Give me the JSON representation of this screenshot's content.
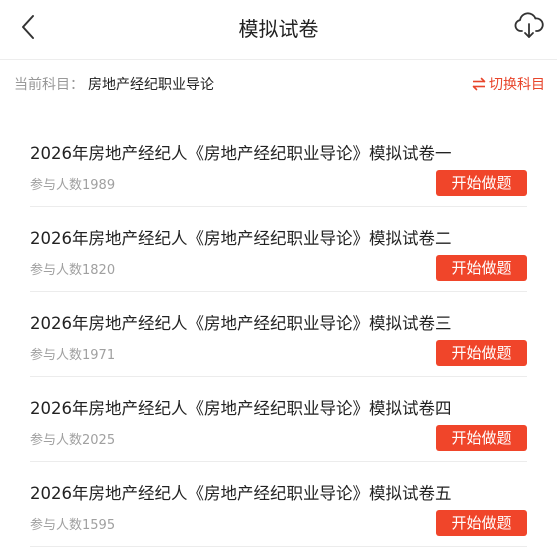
{
  "header": {
    "title": "模拟试卷",
    "back_icon": "chevron-left-icon",
    "download_icon": "cloud-download-icon"
  },
  "subject": {
    "label": "当前科目：",
    "value": "房地产经纪职业导论",
    "switch_label": "切换科目",
    "switch_icon": "swap-arrows-icon"
  },
  "colors": {
    "accent": "#f0452a",
    "muted_text": "#999999",
    "text": "#222222"
  },
  "papers": [
    {
      "title": "2026年房地产经纪人《房地产经纪职业导论》模拟试卷一",
      "participants": "参与人数1989",
      "action": "开始做题"
    },
    {
      "title": "2026年房地产经纪人《房地产经纪职业导论》模拟试卷二",
      "participants": "参与人数1820",
      "action": "开始做题"
    },
    {
      "title": "2026年房地产经纪人《房地产经纪职业导论》模拟试卷三",
      "participants": "参与人数1971",
      "action": "开始做题"
    },
    {
      "title": "2026年房地产经纪人《房地产经纪职业导论》模拟试卷四",
      "participants": "参与人数2025",
      "action": "开始做题"
    },
    {
      "title": "2026年房地产经纪人《房地产经纪职业导论》模拟试卷五",
      "participants": "参与人数1595",
      "action": "开始做题"
    }
  ]
}
